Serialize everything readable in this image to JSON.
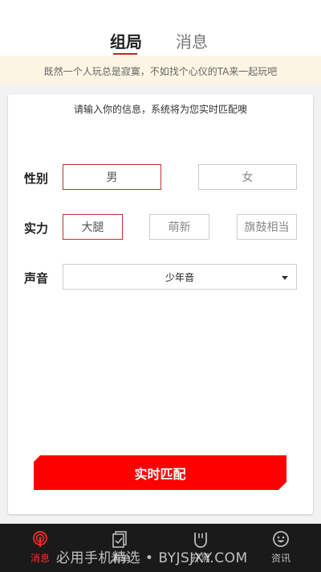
{
  "header": {
    "tabs": [
      {
        "label": "组局",
        "active": true
      },
      {
        "label": "消息",
        "active": false
      }
    ]
  },
  "notice": "既然一个人玩总是寂寞，不如找个心仪的TA来一起玩吧",
  "form": {
    "intro": "请输入你的信息，系统将为您实时匹配噢",
    "gender": {
      "label": "性别",
      "options": [
        {
          "label": "男",
          "selected": true
        },
        {
          "label": "女",
          "selected": false
        }
      ]
    },
    "strength": {
      "label": "实力",
      "options": [
        {
          "label": "大腿",
          "selected": true
        },
        {
          "label": "萌新",
          "selected": false
        },
        {
          "label": "旗鼓相当",
          "selected": false
        }
      ]
    },
    "voice": {
      "label": "声音",
      "value": "少年音"
    },
    "submit_label": "实时匹配"
  },
  "bottom_nav": [
    {
      "label": "消息",
      "icon": "radar-icon",
      "active": true
    },
    {
      "label": "清单",
      "icon": "checklist-icon",
      "active": false
    },
    {
      "label": "开黑",
      "icon": "gamepad-icon",
      "active": false
    },
    {
      "label": "资讯",
      "icon": "smiley-icon",
      "active": false
    }
  ],
  "watermark": "必用手机精选 • BYJSJXY.COM",
  "colors": {
    "accent": "#ff0000",
    "selected_border": "#c0302b",
    "notice_bg": "#fcf5e4",
    "nav_bg": "#1a1a1a",
    "nav_active": "#ff2a2a"
  }
}
